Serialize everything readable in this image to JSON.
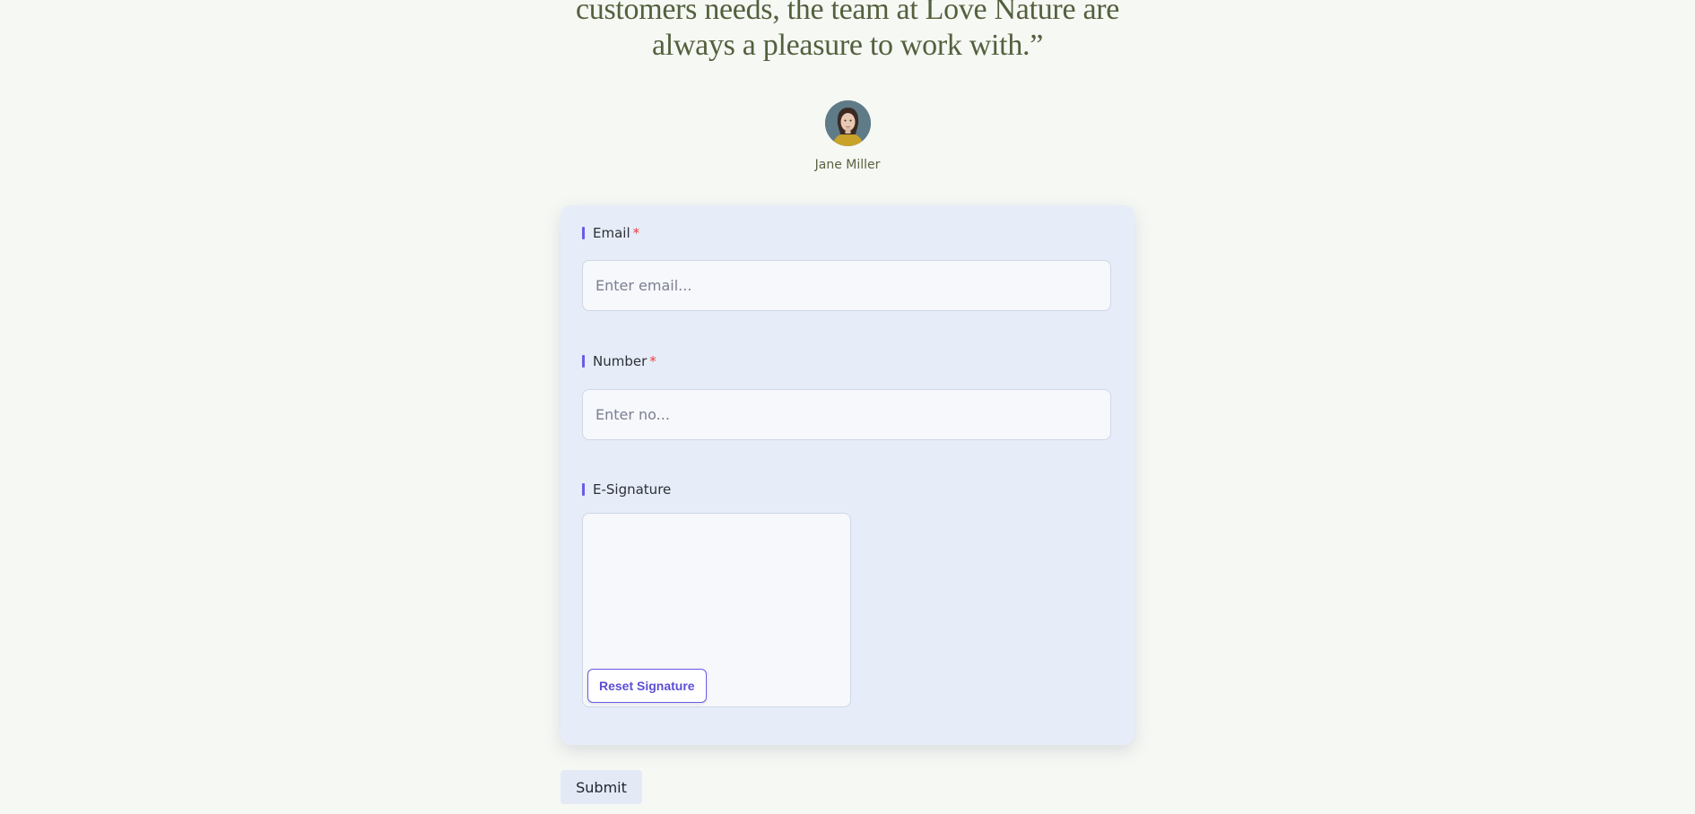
{
  "testimonial": {
    "quote_line_1": "customers needs, the team at Love Nature are",
    "quote_line_2": "always a pleasure to work with.”",
    "author_name": "Jane Miller"
  },
  "form": {
    "email": {
      "label": "Email",
      "required_mark": "*",
      "placeholder": "Enter email..."
    },
    "number": {
      "label": "Number",
      "required_mark": "*",
      "placeholder": "Enter no..."
    },
    "signature": {
      "label": "E-Signature",
      "reset_label": "Reset Signature"
    },
    "submit_label": "Submit"
  },
  "colors": {
    "background": "#f6f8f4",
    "quote_text": "#53603d",
    "form_card": "#e6edf8",
    "accent": "#6b5ce7",
    "required": "#e53e3e"
  }
}
